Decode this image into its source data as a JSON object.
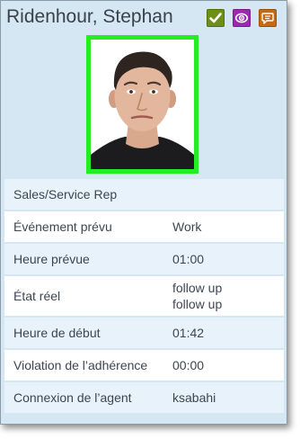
{
  "agent": {
    "name": "Ridenhour, Stephan",
    "role": "Sales/Service Rep"
  },
  "colors": {
    "photo_border": "#22ee22",
    "ready_button": "#6e8f17",
    "monitor_button": "#9c27b0",
    "chat_button": "#c46a12"
  },
  "icons": {
    "ready": "checkmark-icon",
    "monitor": "eye-icon",
    "chat": "chat-bubble-icon"
  },
  "details": [
    {
      "label": "Événement prévu",
      "value": "Work"
    },
    {
      "label": "Heure prévue",
      "value": "01:00"
    },
    {
      "label": "État réel",
      "value_line1": "follow up",
      "value_line2": "follow up"
    },
    {
      "label": "Heure de début",
      "value": "01:42"
    },
    {
      "label": "Violation de l’adhérence",
      "value": "00:00"
    },
    {
      "label": "Connexion de l’agent",
      "value": "ksabahi"
    }
  ]
}
